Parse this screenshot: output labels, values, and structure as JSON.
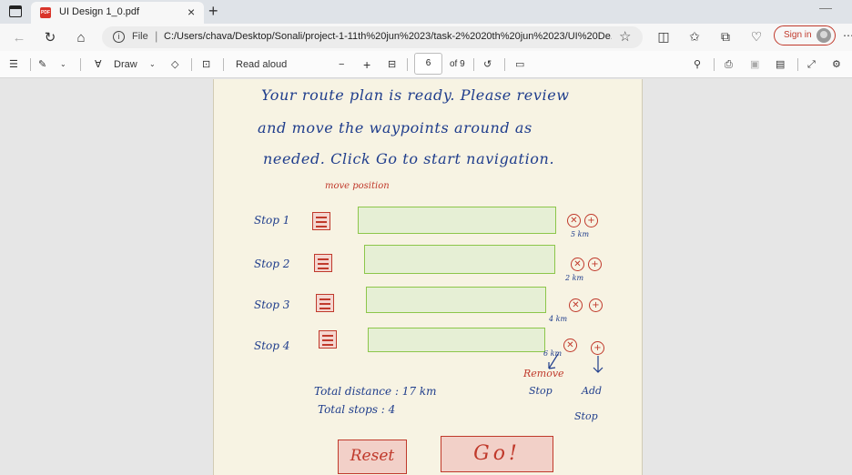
{
  "browser": {
    "tab_title": "UI Design 1_0.pdf",
    "tab_close": "×",
    "new_tab": "+",
    "url_scheme": "File",
    "url": "C:/Users/chava/Desktop/Sonali/project-1-11th%20jun%2023/task-2%2020th%20jun%2023/UI%20De...",
    "sign_in": "Sign in"
  },
  "pdf_toolbar": {
    "draw_label": "Draw",
    "read_aloud_label": "Read aloud",
    "zoom_out": "−",
    "zoom_in": "+",
    "current_page": "6",
    "page_count": "of 9"
  },
  "document": {
    "intro_lines": [
      "Your route plan is ready. Please review",
      "and move the waypoints around as",
      "needed. Click Go to start navigation."
    ],
    "move_position_note": "move position",
    "stops": [
      {
        "label": "Stop 1",
        "distance": "5 km"
      },
      {
        "label": "Stop 2",
        "distance": "2 km"
      },
      {
        "label": "Stop 3",
        "distance": "4 km"
      },
      {
        "label": "Stop 4",
        "distance": "6 km"
      }
    ],
    "remove_symbol": "✕",
    "add_symbol": "+",
    "remove_note_line1": "Remove",
    "remove_note_line2": "Stop",
    "add_note_line1": "Add",
    "add_note_line2": "Stop",
    "total_distance": "Total distance : 17 km",
    "total_stops": "Total stops : 4",
    "reset_label": "Reset",
    "go_label": "Go!"
  },
  "colors": {
    "ink_blue": "#1f3d8c",
    "ink_red": "#c0392b",
    "field_green": "#8cc64a",
    "paper": "#f7f3e3"
  }
}
